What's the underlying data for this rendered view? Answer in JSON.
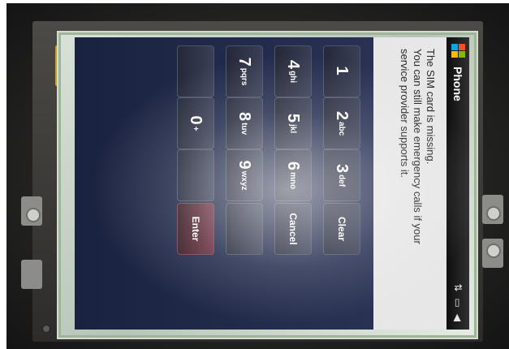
{
  "window": {
    "title": "Phone",
    "status_icons": [
      "no-sim-icon",
      "battery-icon",
      "volume-icon"
    ]
  },
  "message": {
    "line1": "The SIM card is missing.",
    "line2": "You can still make emergency calls if your",
    "line3": "service provider supports it."
  },
  "keypad": {
    "k1": {
      "num": "1",
      "letters": ""
    },
    "k2": {
      "num": "2",
      "letters": "abc"
    },
    "k3": {
      "num": "3",
      "letters": "def"
    },
    "k4": {
      "num": "4",
      "letters": "ghi"
    },
    "k5": {
      "num": "5",
      "letters": "jkl"
    },
    "k6": {
      "num": "6",
      "letters": "mno"
    },
    "k7": {
      "num": "7",
      "letters": "pqrs"
    },
    "k8": {
      "num": "8",
      "letters": "tuv"
    },
    "k9": {
      "num": "9",
      "letters": "wxyz"
    },
    "k0": {
      "num": "0",
      "letters": "+"
    },
    "clear_label": "Clear",
    "cancel_label": "Cancel",
    "enter_label": "Enter"
  },
  "colors": {
    "keypad_bg": "#1f2844",
    "message_bg": "#e7e7e7",
    "enter_key": "#6b3040",
    "panel_tint": "#b7c5b8"
  }
}
